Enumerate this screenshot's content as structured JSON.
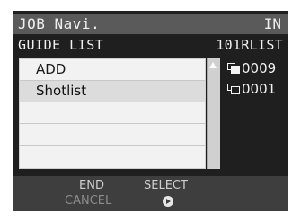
{
  "titlebar": {
    "title": "JOB Navi.",
    "mode": "IN"
  },
  "subheader": {
    "left": "GUIDE LIST",
    "right": "101RLIST"
  },
  "list": {
    "items": [
      {
        "label": "ADD"
      },
      {
        "label": "Shotlist"
      },
      {
        "label": ""
      },
      {
        "label": ""
      },
      {
        "label": ""
      }
    ]
  },
  "counters": [
    {
      "icon": "stacked-frames-filled-icon",
      "value": "0009"
    },
    {
      "icon": "stacked-frames-outline-icon",
      "value": "0001"
    }
  ],
  "footer": {
    "end": "END",
    "select": "SELECT",
    "cancel": "CANCEL",
    "ok_icon": "ok-arrow-icon"
  }
}
